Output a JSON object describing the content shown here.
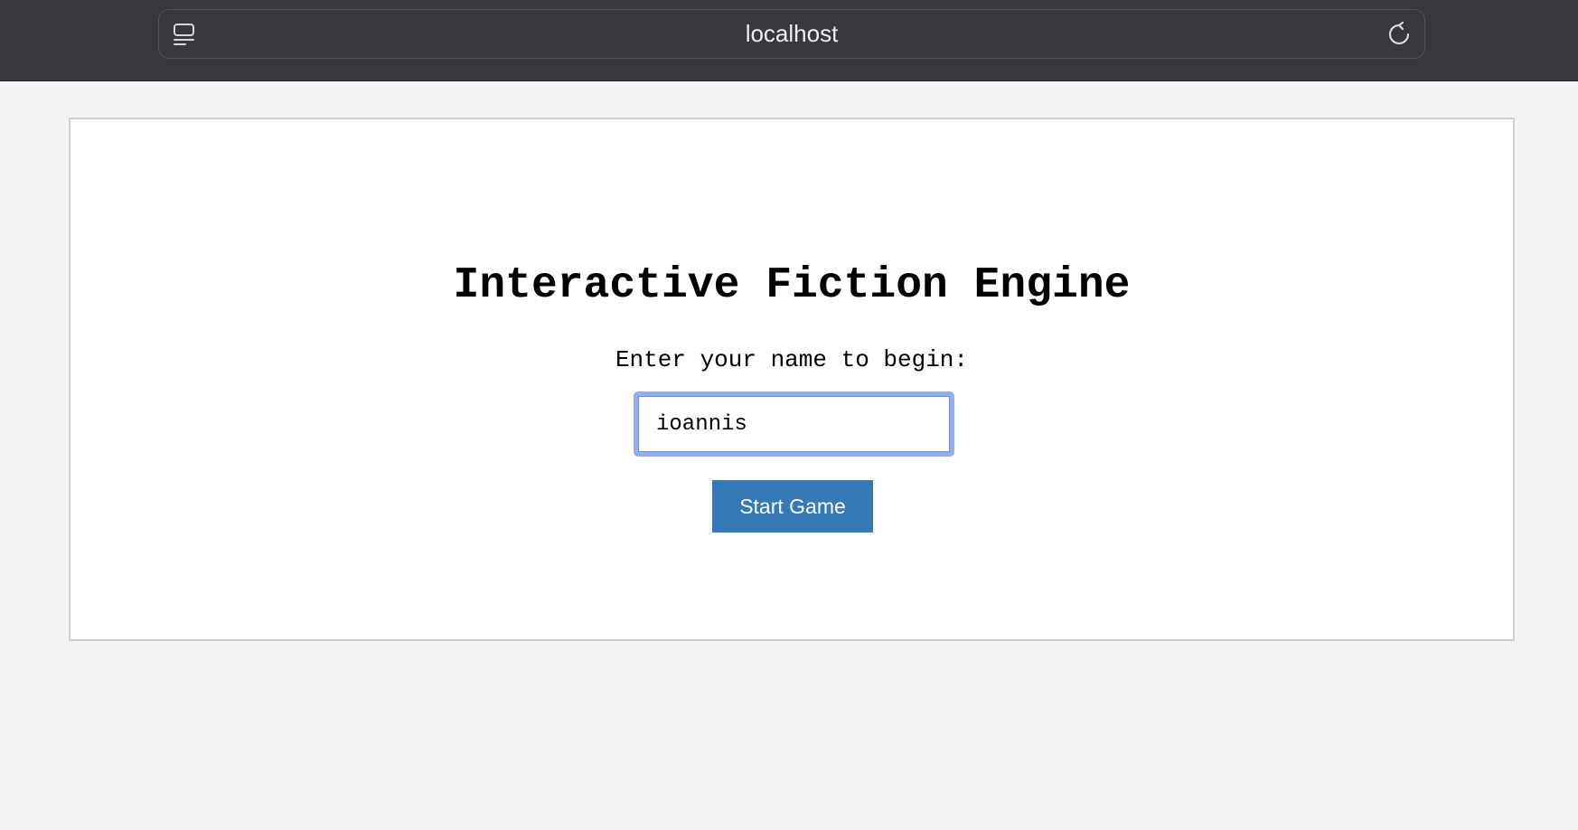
{
  "browser": {
    "url": "localhost",
    "icons": {
      "sidebar": "sidebar-icon",
      "reload": "reload-icon"
    }
  },
  "page": {
    "title": "Interactive Fiction Engine",
    "prompt": "Enter your name to begin:",
    "name_input": {
      "value": "ioannis",
      "placeholder": ""
    },
    "start_button_label": "Start Game"
  },
  "colors": {
    "browser_bar": "#38373c",
    "page_background": "#f4f4f4",
    "card_background": "#ffffff",
    "button": "#357ab7",
    "input_focus_ring": "#8fb0ec"
  }
}
